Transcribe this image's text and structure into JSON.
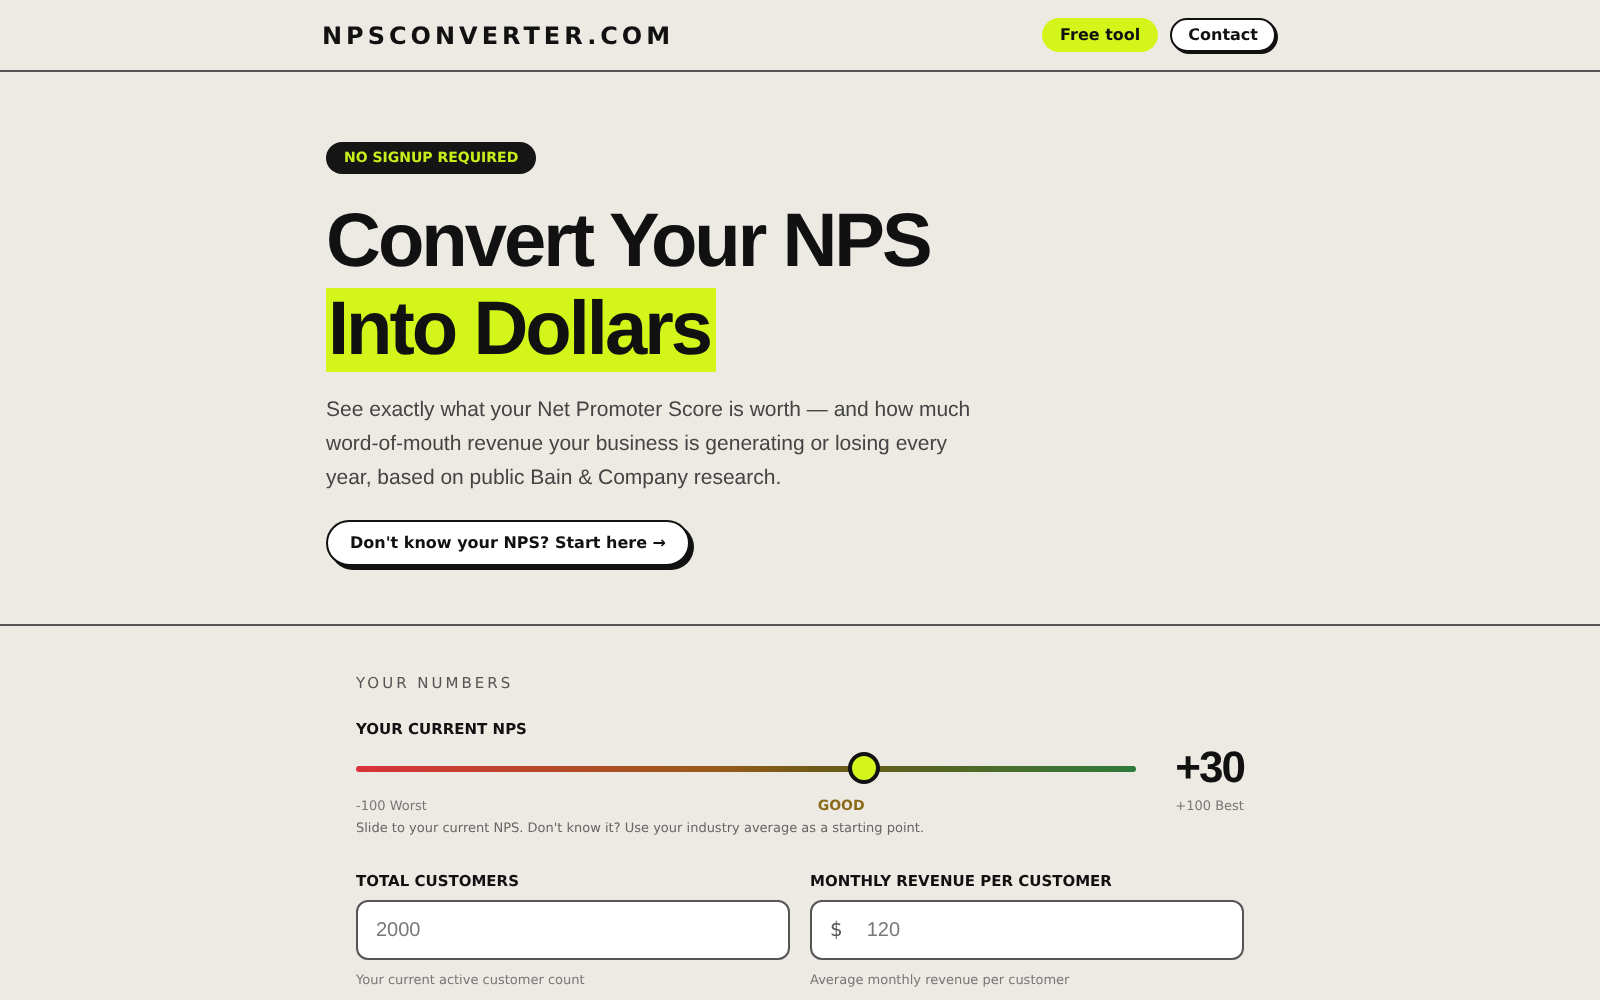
{
  "header": {
    "logo": "NPSCONVERTER.COM",
    "nav": [
      {
        "label": "Free tool",
        "kind": "highlight"
      },
      {
        "label": "Contact",
        "kind": "outline"
      }
    ]
  },
  "hero": {
    "badge": "NO SIGNUP REQUIRED",
    "title_line_1": "Convert Your NPS",
    "title_line_2": "Into Dollars",
    "description": "See exactly what your Net Promoter Score is worth — and how much word-of-mouth revenue your business is generating or losing every year, based on public Bain & Company research.",
    "cta": "Don't know your NPS? Start here →"
  },
  "numbers": {
    "section_label": "YOUR NUMBERS",
    "nps": {
      "label": "YOUR CURRENT NPS",
      "level": 0.65,
      "reading": "+30",
      "min_label": "-100 Worst",
      "max_label": "+100 Best",
      "rating": "GOOD",
      "hint": "Slide to your current NPS. Don't know it? Use your industry average as a starting point."
    },
    "fields": [
      {
        "label": "TOTAL CUSTOMERS",
        "value": "2000",
        "hint": "Your current active customer count"
      },
      {
        "label": "MONTHLY REVENUE PER CUSTOMER",
        "prefix": "$",
        "value": "120",
        "hint": "Average monthly revenue per customer"
      }
    ]
  }
}
